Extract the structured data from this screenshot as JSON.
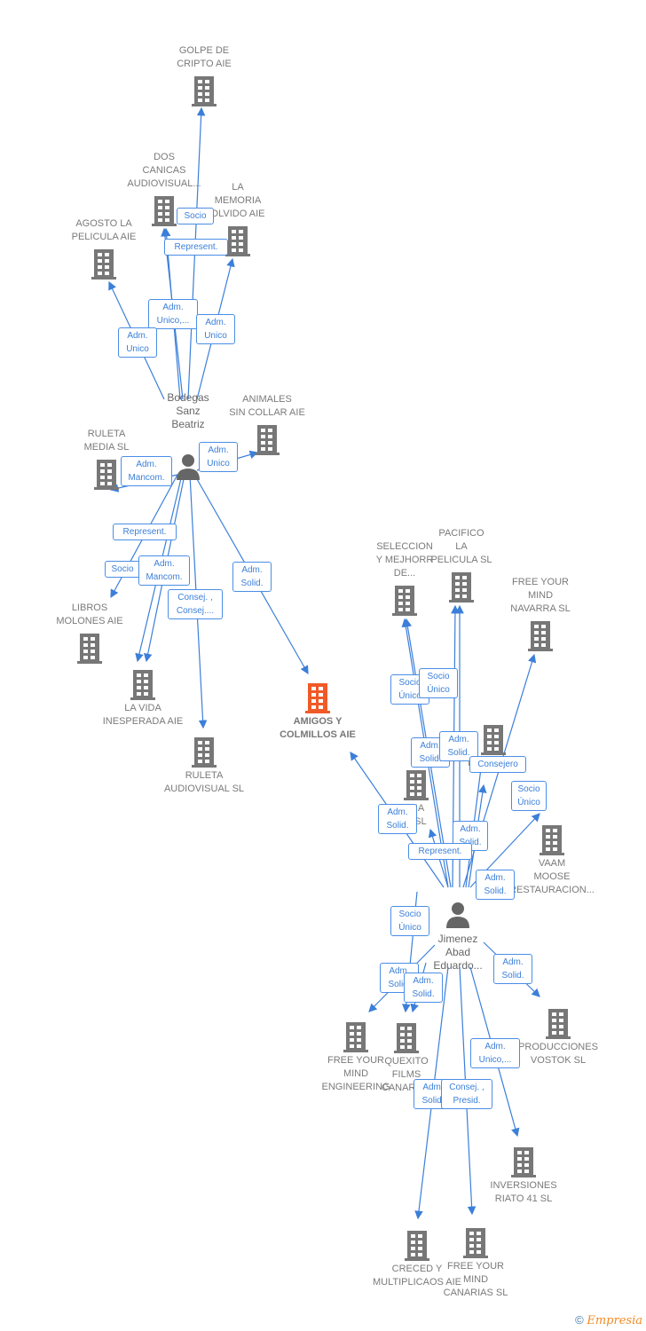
{
  "colors": {
    "company": "#777777",
    "main_company": "#f05a28",
    "edge": "#3b7fd9",
    "person": "#666666"
  },
  "nodes": [
    {
      "id": "golpe",
      "type": "company",
      "label": "GOLPE DE\nCRIPTO AIE"
    },
    {
      "id": "dos",
      "type": "company",
      "label": "DOS\nCANICAS\nAUDIOVISUAL..."
    },
    {
      "id": "memoria",
      "type": "company",
      "label": "LA\nMEMORIA\nOLVIDO AIE"
    },
    {
      "id": "agosto",
      "type": "company",
      "label": "AGOSTO LA\nPELICULA AIE"
    },
    {
      "id": "animales",
      "type": "company",
      "label": "ANIMALES\nSIN COLLAR AIE"
    },
    {
      "id": "bodegas",
      "type": "person",
      "label": "Bodegas\nSanz\nBeatriz"
    },
    {
      "id": "ruletamedia",
      "type": "company",
      "label": "RULETA\nMEDIA SL"
    },
    {
      "id": "libros",
      "type": "company",
      "label": "LIBROS\nMOLONES AIE"
    },
    {
      "id": "lavida",
      "type": "company",
      "label": "LA VIDA\nINESPERADA AIE"
    },
    {
      "id": "ruletaaudio",
      "type": "company",
      "label": "RULETA\nAUDIOVISUAL SL"
    },
    {
      "id": "amigos",
      "type": "main",
      "label": "AMIGOS Y\nCOLMILLOS AIE"
    },
    {
      "id": "seleccion",
      "type": "company",
      "label": "SELECCION\nY MEJHORR\nDE..."
    },
    {
      "id": "pacifico",
      "type": "company",
      "label": "PACIFICO\nLA\nPELICULA  SL"
    },
    {
      "id": "navarra",
      "type": "company",
      "label": "FREE YOUR\nMIND\nNAVARRA  SL"
    },
    {
      "id": "moose",
      "type": "company",
      "label": "MOOSE  SL"
    },
    {
      "id": "ria",
      "type": "company",
      "label": "RIA\nA  SL"
    },
    {
      "id": "vaam",
      "type": "company",
      "label": "VAAM\nMOOSE\nRESTAURACION..."
    },
    {
      "id": "jimenez",
      "type": "person",
      "label": "Jimenez\nAbad\nEduardo..."
    },
    {
      "id": "vostok",
      "type": "company",
      "label": "PRODUCCIONES\nVOSTOK  SL"
    },
    {
      "id": "engineering",
      "type": "company",
      "label": "FREE YOUR\nMIND\nENGINEERING"
    },
    {
      "id": "quexito",
      "type": "company",
      "label": "QUEXITO\nFILMS\nCANARIAS"
    },
    {
      "id": "riato",
      "type": "company",
      "label": "INVERSIONES\nRIATO 41 SL"
    },
    {
      "id": "creced",
      "type": "company",
      "label": "CRECED Y\nMULTIPLICAOS AIE"
    },
    {
      "id": "canarias",
      "type": "company",
      "label": "FREE YOUR\nMIND\nCANARIAS  SL"
    }
  ],
  "edges": [
    {
      "from": "bodegas",
      "to": "golpe",
      "label": "Socio"
    },
    {
      "from": "bodegas",
      "to": "dos",
      "label": "Represent."
    },
    {
      "from": "bodegas",
      "to": "dos",
      "label": "Adm.\nUnico,..."
    },
    {
      "from": "bodegas",
      "to": "memoria",
      "label": "Adm.\nUnico"
    },
    {
      "from": "bodegas",
      "to": "agosto",
      "label": "Adm.\nUnico"
    },
    {
      "from": "bodegas",
      "to": "ruletamedia",
      "label": "Adm.\nMancom."
    },
    {
      "from": "bodegas",
      "to": "animales",
      "label": "Adm.\nUnico"
    },
    {
      "from": "bodegas",
      "to": "libros",
      "label": "Represent."
    },
    {
      "from": "bodegas",
      "to": "lavida",
      "label": "Socio"
    },
    {
      "from": "bodegas",
      "to": "lavida",
      "label": "Adm.\nMancom."
    },
    {
      "from": "bodegas",
      "to": "ruletaaudio",
      "label": "Consej. ,\nConsej...."
    },
    {
      "from": "bodegas",
      "to": "amigos",
      "label": "Adm.\nSolid."
    },
    {
      "from": "jimenez",
      "to": "amigos",
      "label": "Adm.\nSolid."
    },
    {
      "from": "jimenez",
      "to": "seleccion",
      "label": "Socio\nÚnico"
    },
    {
      "from": "jimenez",
      "to": "pacifico",
      "label": "Socio\nÚnico"
    },
    {
      "from": "jimenez",
      "to": "seleccion",
      "label": "Adm.\nSolid."
    },
    {
      "from": "jimenez",
      "to": "pacifico",
      "label": "Adm.\nSolid."
    },
    {
      "from": "jimenez",
      "to": "navarra",
      "label": "Consejero"
    },
    {
      "from": "jimenez",
      "to": "vaam",
      "label": "Socio\nÚnico"
    },
    {
      "from": "jimenez",
      "to": "moose",
      "label": "Adm.\nSolid."
    },
    {
      "from": "jimenez",
      "to": "ria",
      "label": "Represent."
    },
    {
      "from": "jimenez",
      "to": "moose",
      "label": "Adm.\nSolid."
    },
    {
      "from": "jimenez",
      "to": "quexito",
      "label": "Socio\nÚnico"
    },
    {
      "from": "jimenez",
      "to": "engineering",
      "label": "Adm.\nSolid."
    },
    {
      "from": "jimenez",
      "to": "quexito",
      "label": "Adm.\nSolid."
    },
    {
      "from": "jimenez",
      "to": "vostok",
      "label": "Adm.\nSolid."
    },
    {
      "from": "jimenez",
      "to": "riato",
      "label": "Adm.\nUnico,..."
    },
    {
      "from": "jimenez",
      "to": "creced",
      "label": "Adm.\nSolid."
    },
    {
      "from": "jimenez",
      "to": "canarias",
      "label": "Consej. ,\nPresid."
    }
  ],
  "footer": {
    "copyright": "©",
    "brand": "Empresia"
  }
}
